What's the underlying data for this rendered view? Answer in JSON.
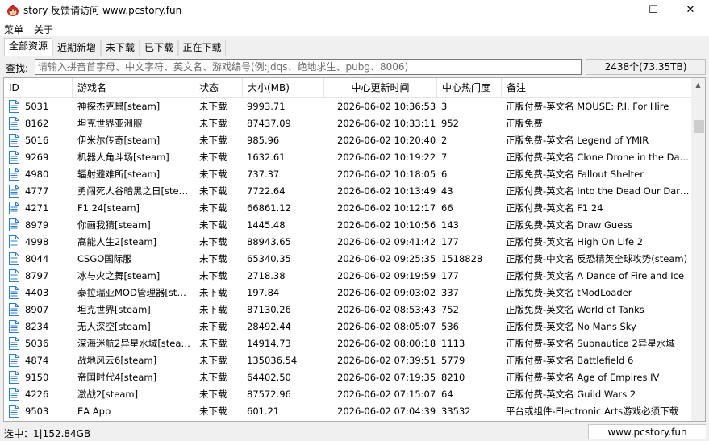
{
  "window": {
    "title": "story 反馈请访问 www.pcstory.fun",
    "app_icon": "red-bird-logo-icon",
    "minimize_glyph": "—",
    "maximize_glyph": "☐",
    "close_glyph": "✕"
  },
  "menu": {
    "items": [
      "菜单",
      "关于"
    ]
  },
  "tabs": [
    {
      "label": "全部资源",
      "active": true
    },
    {
      "label": "近期新增",
      "active": false
    },
    {
      "label": "未下载",
      "active": false
    },
    {
      "label": "已下载",
      "active": false
    },
    {
      "label": "正在下载",
      "active": false
    }
  ],
  "search": {
    "label": "查找:",
    "value": "",
    "placeholder": "请输入拼音首字母、中文字符、英文名、游戏编号(例:jdqs、绝地求生、pubg、8006)"
  },
  "count_text": "2438个(73.35TB)",
  "table": {
    "columns": [
      "ID",
      "游戏名",
      "状态",
      "大小(MB)",
      "中心更新时间",
      "中心热门度",
      "备注"
    ],
    "row_icon": "file-document-icon",
    "rows": [
      [
        "5031",
        "神探杰克鼠[steam]",
        "未下载",
        "9993.71",
        "2026-06-02 10:36:53",
        "3",
        "正版付费-英文名 MOUSE: P.I. For Hire"
      ],
      [
        "8162",
        "坦克世界亚洲服",
        "未下载",
        "87437.09",
        "2026-06-02 10:33:11",
        "952",
        "正版免费"
      ],
      [
        "5016",
        "伊米尔传奇[steam]",
        "未下载",
        "985.96",
        "2026-06-02 10:20:40",
        "2",
        "正版免费-英文名 Legend of YMIR"
      ],
      [
        "9269",
        "机器人角斗场[steam]",
        "未下载",
        "1632.61",
        "2026-06-02 10:19:22",
        "7",
        "正版付费-英文名 Clone Drone in the Danger Zone"
      ],
      [
        "4980",
        "辐射避难所[steam]",
        "未下载",
        "737.37",
        "2026-06-02 10:18:05",
        "6",
        "正版免费-英文名 Fallout Shelter"
      ],
      [
        "4777",
        "勇闯死人谷暗黑之日[steam]",
        "未下载",
        "7722.64",
        "2026-06-02 10:13:49",
        "43",
        "正版付费-英文名 Into the Dead Our Darkest Days"
      ],
      [
        "4271",
        "F1 24[steam]",
        "未下载",
        "66861.12",
        "2026-06-02 10:12:17",
        "66",
        "正版付费-英文名 F1 24"
      ],
      [
        "8979",
        "你画我猜[steam]",
        "未下载",
        "1445.48",
        "2026-06-02 10:10:56",
        "143",
        "正版免费-英文名 Draw Guess"
      ],
      [
        "4998",
        "高能人生2[steam]",
        "未下载",
        "88943.65",
        "2026-06-02 09:41:42",
        "177",
        "正版付费-英文名 High On Life 2"
      ],
      [
        "8044",
        "CSGO国际服",
        "未下载",
        "65340.35",
        "2026-06-02 09:25:35",
        "1518828",
        "正版付费-中文名 反恐精英全球攻势(steam)"
      ],
      [
        "8797",
        "冰与火之舞[steam]",
        "未下载",
        "2718.38",
        "2026-06-02 09:19:59",
        "177",
        "正版付费-英文名 A Dance of Fire and Ice"
      ],
      [
        "4403",
        "泰拉瑞亚MOD管理器[steam]",
        "未下载",
        "197.84",
        "2026-06-02 09:03:02",
        "337",
        "正版免费-英文名 tModLoader"
      ],
      [
        "8907",
        "坦克世界[steam]",
        "未下载",
        "87130.26",
        "2026-06-02 08:53:43",
        "752",
        "正版免费-英文名 World of Tanks"
      ],
      [
        "8234",
        "无人深空[steam]",
        "未下载",
        "28492.44",
        "2026-06-02 08:05:07",
        "536",
        "正版付费-英文名 No Mans Sky"
      ],
      [
        "5036",
        "深海迷航2异星水域[steam]",
        "未下载",
        "14914.73",
        "2026-06-02 08:00:18",
        "1113",
        "正版付费-英文名 Subnautica 2异星水域"
      ],
      [
        "4874",
        "战地风云6[steam]",
        "未下载",
        "135036.54",
        "2026-06-02 07:39:51",
        "5779",
        "正版付费-英文名 Battlefield 6"
      ],
      [
        "9150",
        "帝国时代4[steam]",
        "未下载",
        "64402.50",
        "2026-06-02 07:19:35",
        "8210",
        "正版付费-英文名 Age of Empires IV"
      ],
      [
        "4226",
        "激战2[steam]",
        "未下载",
        "87572.96",
        "2026-06-02 07:15:07",
        "64",
        "正版付费-英文名 Guild Wars 2"
      ],
      [
        "9503",
        "EA App",
        "未下载",
        "601.21",
        "2026-06-02 07:04:39",
        "33532",
        "平台或组件-Electronic Arts游戏必须下载"
      ]
    ]
  },
  "status": {
    "selection": "选中：1|152.84GB",
    "site": "www.pcstory.fun"
  }
}
